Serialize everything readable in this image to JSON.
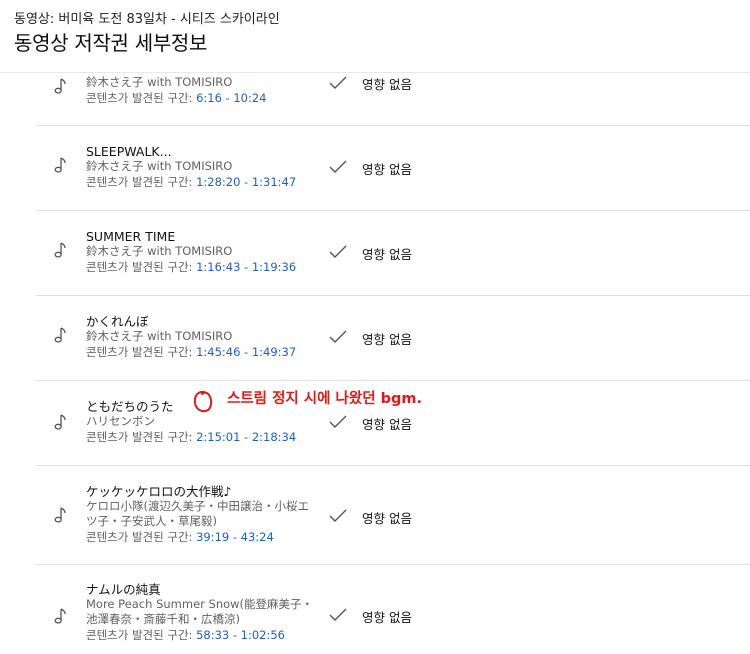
{
  "header": {
    "subtitle": "동영상: 버미육 도전 83일차 - 시티즈 스카이라인",
    "title": "동영상 저작권 세부정보"
  },
  "found_label": "콘텐츠가 발견된 구간: ",
  "impact_label": "영향 없음",
  "rows": [
    {
      "song": "",
      "artist": "鈴木さえ子 with TOMISIRO",
      "range": "6:16 - 10:24"
    },
    {
      "song": "SLEEPWALK...",
      "artist": "鈴木さえ子 with TOMISIRO",
      "range": "1:28:20 - 1:31:47"
    },
    {
      "song": "SUMMER TIME",
      "artist": "鈴木さえ子 with TOMISIRO",
      "range": "1:16:43 - 1:19:36"
    },
    {
      "song": "かくれんぼ",
      "artist": "鈴木さえ子 with TOMISIRO",
      "range": "1:45:46 - 1:49:37"
    },
    {
      "song": "ともだちのうた",
      "artist": "ハリセンボン",
      "range": "2:15:01 - 2:18:34"
    },
    {
      "song": "ケッケッケロロの大作戦♪",
      "artist": "ケロロ小隊(渡辺久美子・中田譲治・小桜エツ子・子安武人・草尾毅)",
      "range": "39:19 - 43:24"
    },
    {
      "song": "ナムルの純真",
      "artist": "More Peach Summer Snow(能登麻美子・池澤春奈・斎藤千和・広橋涼)",
      "range": "58:33 - 1:02:56"
    }
  ],
  "annotation": {
    "text": "스트림 정지 시에 나왔던 bgm.",
    "color": "#e01818"
  },
  "colors": {
    "link_range": "#1a5fc7",
    "secondary_text": "#606060",
    "separator": "#e0e0e0"
  },
  "icons": {
    "song": "music-note-icon",
    "status": "checkmark-icon"
  }
}
